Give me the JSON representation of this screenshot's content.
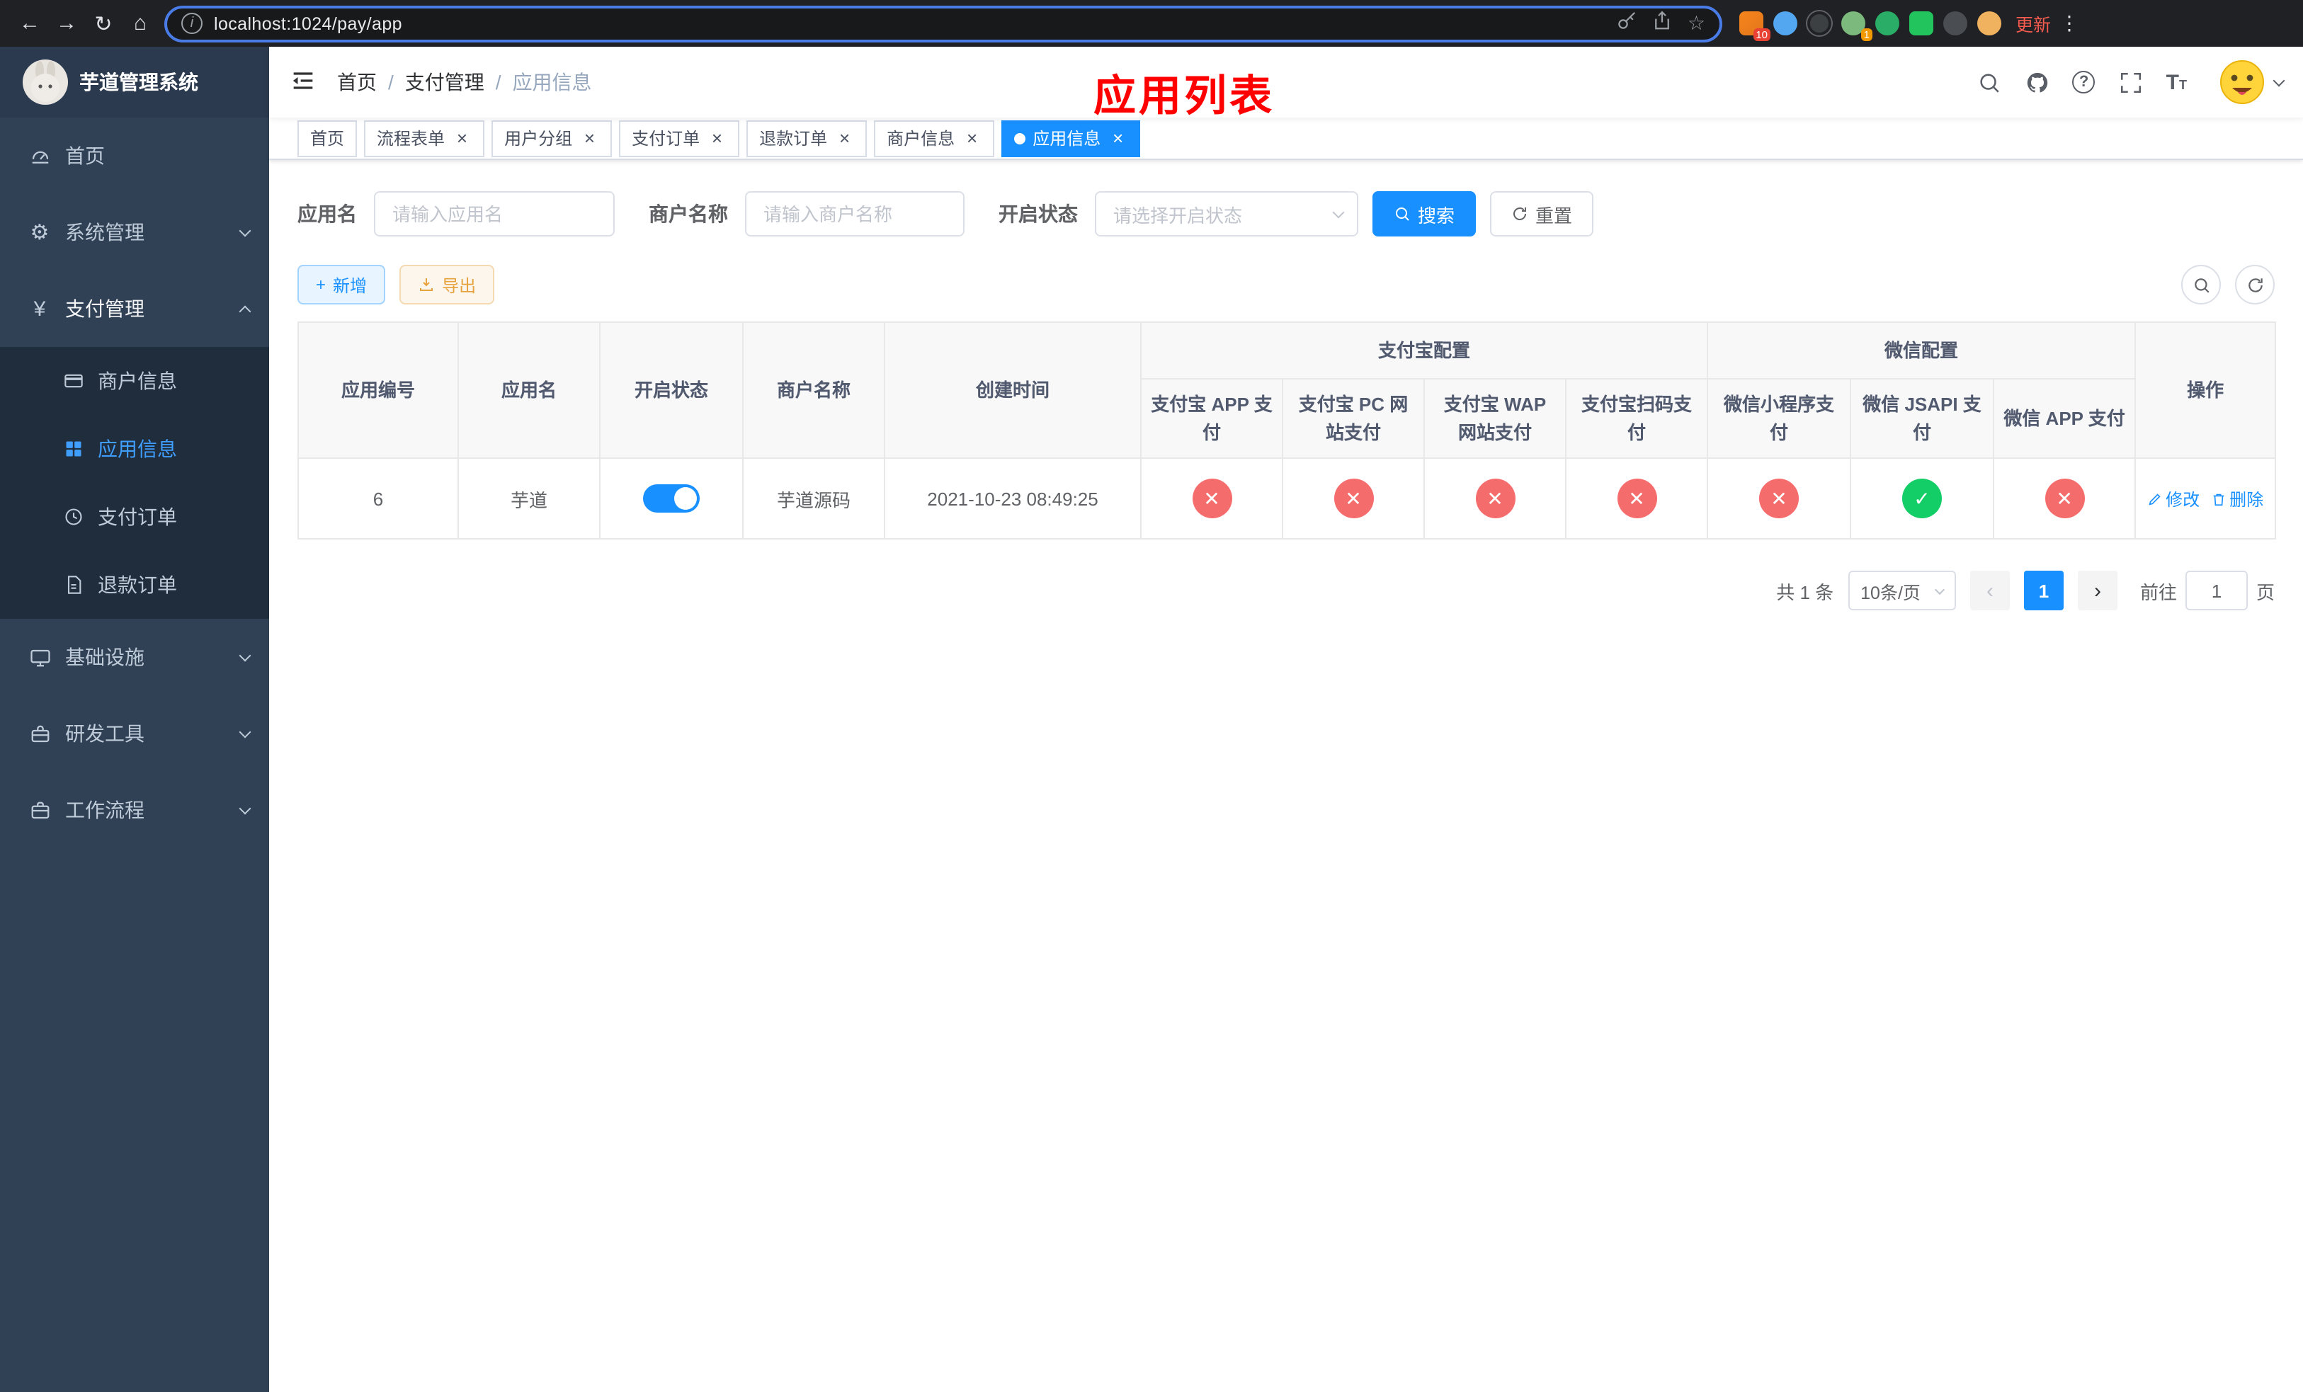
{
  "colors": {
    "accent": "#1890ff",
    "sidebar_bg": "#304156",
    "sidebar_submenu_bg": "#1f2d3d",
    "sidebar_active_text": "#409eff",
    "danger": "#f56c6c",
    "success": "#13ce66",
    "warning": "#e6a23c",
    "annotation_red": "#ff0000"
  },
  "browser": {
    "url": "localhost:1024/pay/app",
    "update_label": "更新",
    "ext_badge_first": "10",
    "ext_badge_avatar": "1"
  },
  "sidebar": {
    "title": "芋道管理系统",
    "items": [
      {
        "label": "首页"
      },
      {
        "label": "系统管理"
      },
      {
        "label": "支付管理",
        "children": [
          {
            "label": "商户信息"
          },
          {
            "label": "应用信息"
          },
          {
            "label": "支付订单"
          },
          {
            "label": "退款订单"
          }
        ]
      },
      {
        "label": "基础设施"
      },
      {
        "label": "研发工具"
      },
      {
        "label": "工作流程"
      }
    ]
  },
  "header": {
    "breadcrumb": [
      "首页",
      "支付管理",
      "应用信息"
    ],
    "page_title": "应用列表"
  },
  "tabs": [
    {
      "label": "首页"
    },
    {
      "label": "流程表单"
    },
    {
      "label": "用户分组"
    },
    {
      "label": "支付订单"
    },
    {
      "label": "退款订单"
    },
    {
      "label": "商户信息"
    },
    {
      "label": "应用信息"
    }
  ],
  "filters": {
    "app_name_label": "应用名",
    "app_name_placeholder": "请输入应用名",
    "merchant_label": "商户名称",
    "merchant_placeholder": "请输入商户名称",
    "status_label": "开启状态",
    "status_placeholder": "请选择开启状态",
    "search_label": "搜索",
    "reset_label": "重置"
  },
  "toolbar": {
    "add_label": "新增",
    "export_label": "导出"
  },
  "table": {
    "columns": {
      "app_id": "应用编号",
      "app_name": "应用名",
      "status": "开启状态",
      "merchant": "商户名称",
      "created": "创建时间",
      "alipay_group": "支付宝配置",
      "wechat_group": "微信配置",
      "alipay_app": "支付宝 APP 支付",
      "alipay_pc": "支付宝 PC 网站支付",
      "alipay_wap": "支付宝 WAP 网站支付",
      "alipay_qr": "支付宝扫码支付",
      "wx_mini": "微信小程序支付",
      "wx_jsapi": "微信 JSAPI 支付",
      "wx_app": "微信 APP 支付",
      "ops": "操作"
    },
    "rows": [
      {
        "id": "6",
        "name": "芋道",
        "enabled": true,
        "merchant": "芋道源码",
        "created": "2021-10-23 08:49:25",
        "configs": [
          false,
          false,
          false,
          false,
          false,
          true,
          false
        ],
        "edit_label": "修改",
        "delete_label": "删除"
      }
    ]
  },
  "pagination": {
    "total": "共 1 条",
    "page_size": "10条/页",
    "page": "1",
    "goto_prefix": "前往",
    "goto_value": "1",
    "goto_suffix": "页"
  },
  "icons": {
    "back": "←",
    "forward": "→",
    "reload": "↻",
    "home": "⌂",
    "star": "☆",
    "dots": "⋮",
    "close": "×",
    "check": "✓",
    "cross": "✕",
    "prev": "‹",
    "next": "›",
    "plus": "+",
    "gear": "⚙",
    "yen": "¥",
    "question": "?",
    "info": "i"
  }
}
